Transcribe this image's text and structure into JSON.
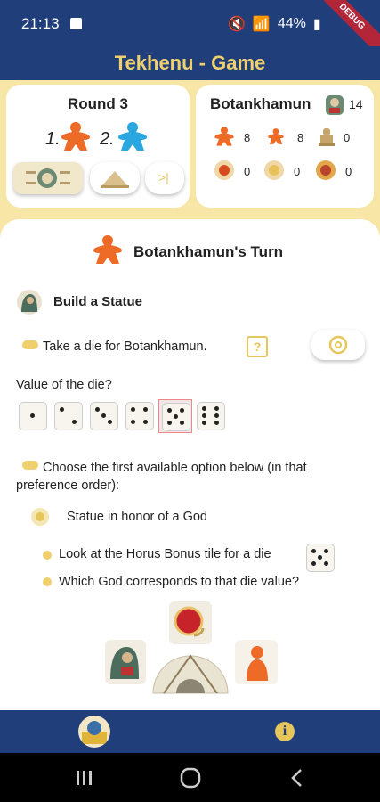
{
  "status_bar": {
    "time": "21:13",
    "battery": "44%"
  },
  "debug_ribbon": "DEBUG",
  "app_bar": {
    "title": "Tekhenu - Game"
  },
  "round_card": {
    "title": "Round 3",
    "ranks": [
      "1.",
      "2."
    ],
    "colors": {
      "first": "#ee6b27",
      "second": "#2aa6e0"
    },
    "next_icon": ">|"
  },
  "bot_card": {
    "name": "Botankhamun",
    "score": "14",
    "stats": [
      {
        "icon": "orange-meeple-icon",
        "value": "8"
      },
      {
        "icon": "small-orange-meeple-icon",
        "value": "8"
      },
      {
        "icon": "statue-icon",
        "value": "0"
      },
      {
        "icon": "red-token-icon",
        "value": "0"
      },
      {
        "icon": "sun-token-icon",
        "value": "0"
      },
      {
        "icon": "lion-token-icon",
        "value": "0"
      }
    ]
  },
  "turn": {
    "title": "Botankhamun's Turn",
    "action": "Build a Statue",
    "take_die": "Take a die for Botankhamun.",
    "help_icon": "?",
    "die_question": "Value of the die?",
    "die_values": [
      1,
      2,
      3,
      4,
      5,
      6
    ],
    "selected_die": 5,
    "choose_text": "Choose the first available option below (in that preference order):",
    "option_label": "Statue in honor of a God",
    "horus_text": "Look at the Horus Bonus tile for a die",
    "god_text": "Which God corresponds to that die value?"
  },
  "bottom_nav": {
    "info_icon": "i"
  }
}
